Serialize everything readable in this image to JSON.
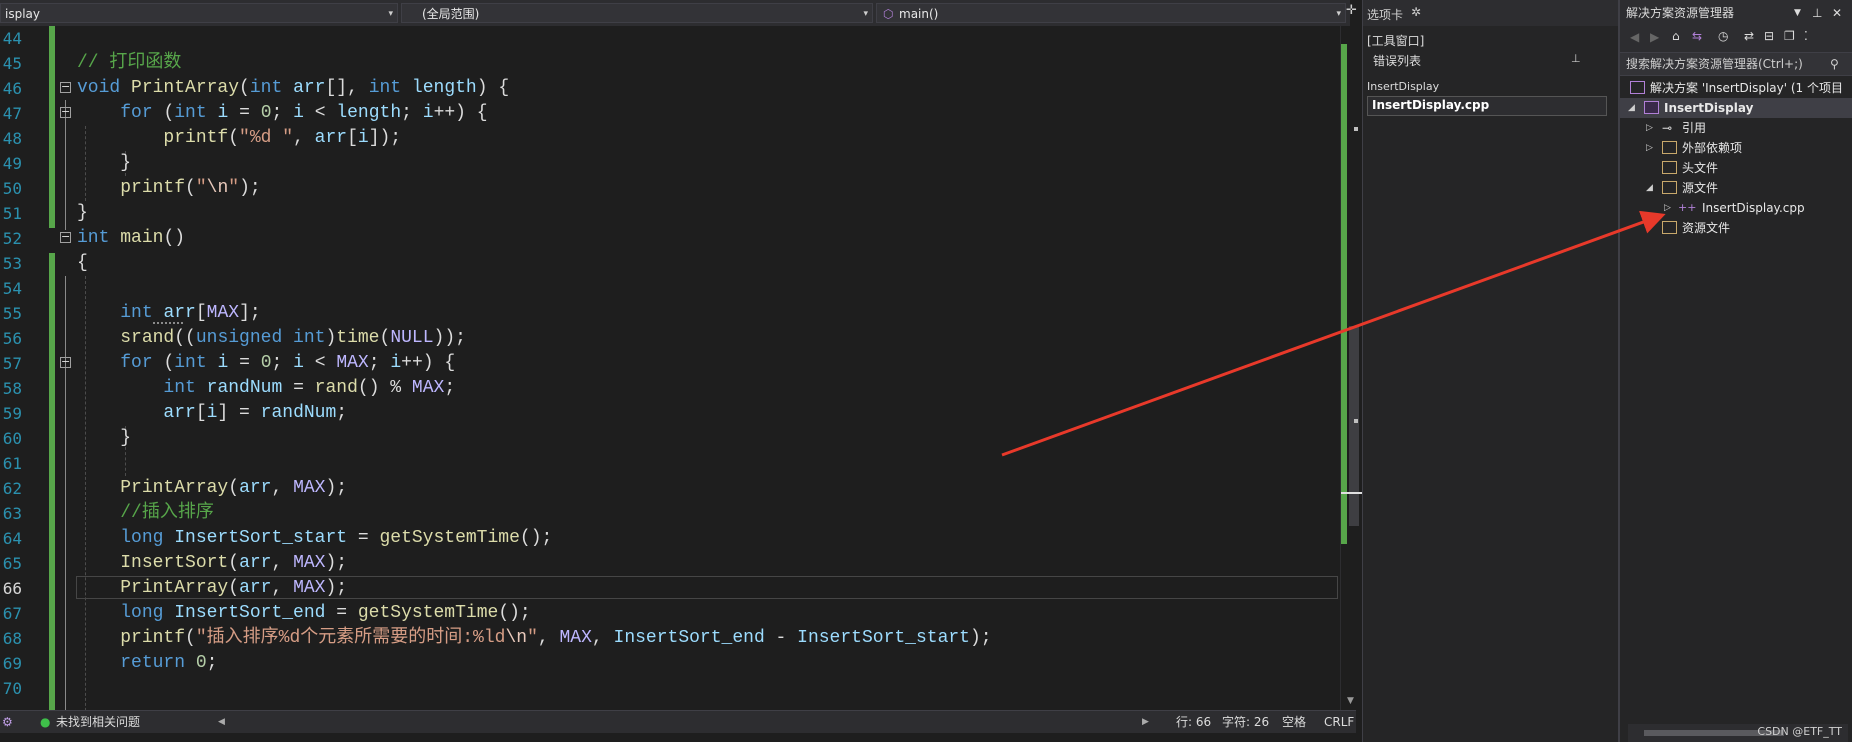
{
  "nav": {
    "project_dropdown": "isplay",
    "scope_dropdown": "(全局范围)",
    "member_dropdown": "main()"
  },
  "code": {
    "lines": [
      {
        "num": "44",
        "tokens": []
      },
      {
        "num": "45",
        "tokens": [
          {
            "c": "com",
            "t": "// 打印函数"
          }
        ]
      },
      {
        "num": "46",
        "tokens": [
          {
            "c": "kw",
            "t": "void "
          },
          {
            "c": "fn",
            "t": "PrintArray"
          },
          {
            "c": "txt",
            "t": "("
          },
          {
            "c": "kw",
            "t": "int "
          },
          {
            "c": "var",
            "t": "arr"
          },
          {
            "c": "txt",
            "t": "[], "
          },
          {
            "c": "kw",
            "t": "int "
          },
          {
            "c": "var",
            "t": "length"
          },
          {
            "c": "txt",
            "t": ") {"
          }
        ]
      },
      {
        "num": "47",
        "tokens": [
          {
            "c": "txt",
            "t": "    "
          },
          {
            "c": "kw",
            "t": "for "
          },
          {
            "c": "txt",
            "t": "("
          },
          {
            "c": "kw",
            "t": "int "
          },
          {
            "c": "var",
            "t": "i"
          },
          {
            "c": "txt",
            "t": " = "
          },
          {
            "c": "num",
            "t": "0"
          },
          {
            "c": "txt",
            "t": "; "
          },
          {
            "c": "var",
            "t": "i"
          },
          {
            "c": "txt",
            "t": " < "
          },
          {
            "c": "var",
            "t": "length"
          },
          {
            "c": "txt",
            "t": "; "
          },
          {
            "c": "var",
            "t": "i"
          },
          {
            "c": "txt",
            "t": "++) {"
          }
        ]
      },
      {
        "num": "48",
        "tokens": [
          {
            "c": "txt",
            "t": "        "
          },
          {
            "c": "fn",
            "t": "printf"
          },
          {
            "c": "txt",
            "t": "("
          },
          {
            "c": "str",
            "t": "\"%d \""
          },
          {
            "c": "txt",
            "t": ", "
          },
          {
            "c": "var",
            "t": "arr"
          },
          {
            "c": "txt",
            "t": "["
          },
          {
            "c": "var",
            "t": "i"
          },
          {
            "c": "txt",
            "t": "]);"
          }
        ]
      },
      {
        "num": "49",
        "tokens": [
          {
            "c": "txt",
            "t": "    }"
          }
        ]
      },
      {
        "num": "50",
        "tokens": [
          {
            "c": "txt",
            "t": "    "
          },
          {
            "c": "fn",
            "t": "printf"
          },
          {
            "c": "txt",
            "t": "("
          },
          {
            "c": "str",
            "t": "\""
          },
          {
            "c": "esc",
            "t": "\\n"
          },
          {
            "c": "str",
            "t": "\""
          },
          {
            "c": "txt",
            "t": ");"
          }
        ]
      },
      {
        "num": "51",
        "tokens": [
          {
            "c": "txt",
            "t": "}"
          }
        ]
      },
      {
        "num": "52",
        "tokens": [
          {
            "c": "kw",
            "t": "int "
          },
          {
            "c": "fn",
            "t": "main"
          },
          {
            "c": "txt",
            "t": "()"
          }
        ]
      },
      {
        "num": "53",
        "tokens": [
          {
            "c": "txt",
            "t": "{"
          }
        ]
      },
      {
        "num": "54",
        "tokens": []
      },
      {
        "num": "55",
        "tokens": [
          {
            "c": "txt",
            "t": "    "
          },
          {
            "c": "kw",
            "t": "int "
          },
          {
            "c": "var",
            "t": "arr"
          },
          {
            "c": "txt",
            "t": "["
          },
          {
            "c": "mac",
            "t": "MAX"
          },
          {
            "c": "txt",
            "t": "];"
          }
        ]
      },
      {
        "num": "56",
        "tokens": [
          {
            "c": "txt",
            "t": "    "
          },
          {
            "c": "fn",
            "t": "srand"
          },
          {
            "c": "txt",
            "t": "(("
          },
          {
            "c": "kw",
            "t": "unsigned int"
          },
          {
            "c": "txt",
            "t": ")"
          },
          {
            "c": "fn",
            "t": "time"
          },
          {
            "c": "txt",
            "t": "("
          },
          {
            "c": "mac",
            "t": "NULL"
          },
          {
            "c": "txt",
            "t": "));"
          }
        ]
      },
      {
        "num": "57",
        "tokens": [
          {
            "c": "txt",
            "t": "    "
          },
          {
            "c": "kw",
            "t": "for "
          },
          {
            "c": "txt",
            "t": "("
          },
          {
            "c": "kw",
            "t": "int "
          },
          {
            "c": "var",
            "t": "i"
          },
          {
            "c": "txt",
            "t": " = "
          },
          {
            "c": "num",
            "t": "0"
          },
          {
            "c": "txt",
            "t": "; "
          },
          {
            "c": "var",
            "t": "i"
          },
          {
            "c": "txt",
            "t": " < "
          },
          {
            "c": "mac",
            "t": "MAX"
          },
          {
            "c": "txt",
            "t": "; "
          },
          {
            "c": "var",
            "t": "i"
          },
          {
            "c": "txt",
            "t": "++) {"
          }
        ]
      },
      {
        "num": "58",
        "tokens": [
          {
            "c": "txt",
            "t": "        "
          },
          {
            "c": "kw",
            "t": "int "
          },
          {
            "c": "var",
            "t": "randNum"
          },
          {
            "c": "txt",
            "t": " = "
          },
          {
            "c": "fn",
            "t": "rand"
          },
          {
            "c": "txt",
            "t": "() % "
          },
          {
            "c": "mac",
            "t": "MAX"
          },
          {
            "c": "txt",
            "t": ";"
          }
        ]
      },
      {
        "num": "59",
        "tokens": [
          {
            "c": "txt",
            "t": "        "
          },
          {
            "c": "var",
            "t": "arr"
          },
          {
            "c": "txt",
            "t": "["
          },
          {
            "c": "var",
            "t": "i"
          },
          {
            "c": "txt",
            "t": "] = "
          },
          {
            "c": "var",
            "t": "randNum"
          },
          {
            "c": "txt",
            "t": ";"
          }
        ]
      },
      {
        "num": "60",
        "tokens": [
          {
            "c": "txt",
            "t": "    }"
          }
        ]
      },
      {
        "num": "61",
        "tokens": []
      },
      {
        "num": "62",
        "tokens": [
          {
            "c": "txt",
            "t": "    "
          },
          {
            "c": "fn",
            "t": "PrintArray"
          },
          {
            "c": "txt",
            "t": "("
          },
          {
            "c": "var",
            "t": "arr"
          },
          {
            "c": "txt",
            "t": ", "
          },
          {
            "c": "mac",
            "t": "MAX"
          },
          {
            "c": "txt",
            "t": ");"
          }
        ]
      },
      {
        "num": "63",
        "tokens": [
          {
            "c": "txt",
            "t": "    "
          },
          {
            "c": "com",
            "t": "//插入排序"
          }
        ]
      },
      {
        "num": "64",
        "tokens": [
          {
            "c": "txt",
            "t": "    "
          },
          {
            "c": "kw",
            "t": "long "
          },
          {
            "c": "var",
            "t": "InsertSort_start"
          },
          {
            "c": "txt",
            "t": " = "
          },
          {
            "c": "fn",
            "t": "getSystemTime"
          },
          {
            "c": "txt",
            "t": "();"
          }
        ]
      },
      {
        "num": "65",
        "tokens": [
          {
            "c": "txt",
            "t": "    "
          },
          {
            "c": "fn",
            "t": "InsertSort"
          },
          {
            "c": "txt",
            "t": "("
          },
          {
            "c": "var",
            "t": "arr"
          },
          {
            "c": "txt",
            "t": ", "
          },
          {
            "c": "mac",
            "t": "MAX"
          },
          {
            "c": "txt",
            "t": ");"
          }
        ]
      },
      {
        "num": "66",
        "tokens": [
          {
            "c": "txt",
            "t": "    "
          },
          {
            "c": "fn",
            "t": "PrintArray"
          },
          {
            "c": "txt",
            "t": "("
          },
          {
            "c": "var",
            "t": "arr"
          },
          {
            "c": "txt",
            "t": ", "
          },
          {
            "c": "mac",
            "t": "MAX"
          },
          {
            "c": "txt",
            "t": ");"
          }
        ]
      },
      {
        "num": "67",
        "tokens": [
          {
            "c": "txt",
            "t": "    "
          },
          {
            "c": "kw",
            "t": "long "
          },
          {
            "c": "var",
            "t": "InsertSort_end"
          },
          {
            "c": "txt",
            "t": " = "
          },
          {
            "c": "fn",
            "t": "getSystemTime"
          },
          {
            "c": "txt",
            "t": "();"
          }
        ]
      },
      {
        "num": "68",
        "tokens": [
          {
            "c": "txt",
            "t": "    "
          },
          {
            "c": "fn",
            "t": "printf"
          },
          {
            "c": "txt",
            "t": "("
          },
          {
            "c": "str",
            "t": "\"插入排序%d个元素所需要的时间:%ld"
          },
          {
            "c": "esc",
            "t": "\\n"
          },
          {
            "c": "str",
            "t": "\""
          },
          {
            "c": "txt",
            "t": ", "
          },
          {
            "c": "mac",
            "t": "MAX"
          },
          {
            "c": "txt",
            "t": ", "
          },
          {
            "c": "var",
            "t": "InsertSort_end"
          },
          {
            "c": "txt",
            "t": " - "
          },
          {
            "c": "var",
            "t": "InsertSort_start"
          },
          {
            "c": "txt",
            "t": ");"
          }
        ]
      },
      {
        "num": "69",
        "tokens": [
          {
            "c": "txt",
            "t": "    "
          },
          {
            "c": "kw",
            "t": "return "
          },
          {
            "c": "num",
            "t": "0"
          },
          {
            "c": "txt",
            "t": ";"
          }
        ]
      },
      {
        "num": "70",
        "tokens": []
      }
    ],
    "current_line": "66"
  },
  "status": {
    "issues": "未找到相关问题",
    "line": "行: 66",
    "col": "字符: 26",
    "spaces": "空格",
    "eol": "CRLF"
  },
  "tabs_panel": {
    "title": "选项卡",
    "tool_windows": "[工具窗口]",
    "error_list": "错误列表",
    "project_group": "InsertDisplay",
    "active_file": "InsertDisplay.cpp"
  },
  "solution_explorer": {
    "title": "解决方案资源管理器",
    "search_placeholder": "搜索解决方案资源管理器(Ctrl+;)",
    "solution": "解决方案 'InsertDisplay' (1 个项目",
    "project": "InsertDisplay",
    "references": "引用",
    "external_deps": "外部依赖项",
    "header_files": "头文件",
    "source_files": "源文件",
    "source_file": "InsertDisplay.cpp",
    "resource_files": "资源文件"
  },
  "watermark": "CSDN @ETF_TT",
  "colors": {
    "editor_bg": "#1e1e1e",
    "keyword": "#569cd6",
    "comment": "#57a64a",
    "function": "#dcdcaa",
    "string": "#d69d85",
    "macro": "#beb7ff",
    "variable": "#9cdcfe",
    "change_bar": "#57a64a",
    "arrow": "#e8392a"
  },
  "icons": [
    "chevron-down-icon",
    "gear-icon",
    "pin-icon",
    "close-icon",
    "search-icon",
    "fold-minus-icon",
    "check-circle-icon",
    "cpp-file-icon",
    "folder-filter-icon",
    "solution-icon",
    "project-icon",
    "references-icon",
    "home-icon",
    "refresh-icon",
    "sync-icon",
    "collapse-icon"
  ]
}
